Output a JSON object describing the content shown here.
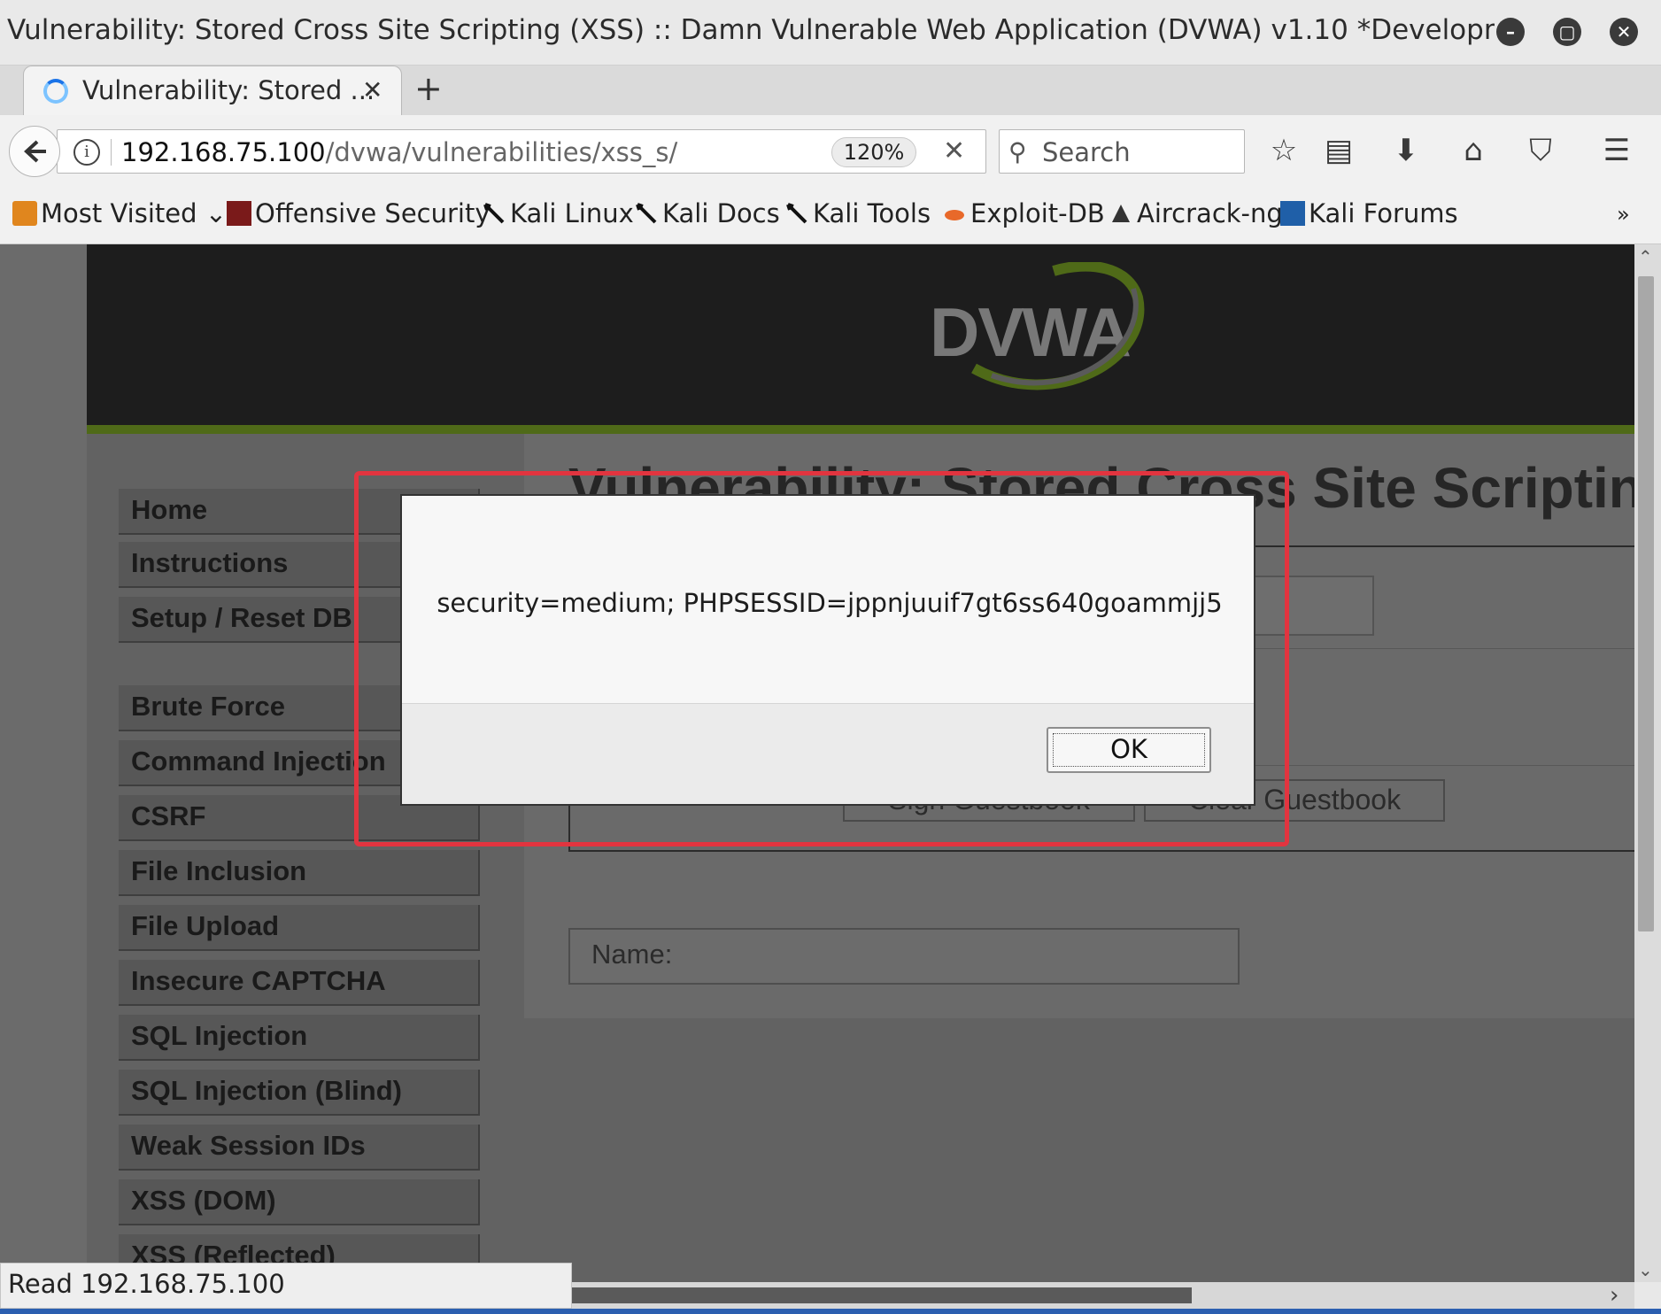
{
  "window": {
    "title": "Vulnerability: Stored Cross Site Scripting (XSS) :: Damn Vulnerable Web Application (DVWA) v1.10 *Development* - Mozill...",
    "minimize_glyph": "–",
    "maximize_glyph": "▢",
    "close_glyph": "✕"
  },
  "tab": {
    "label": "Vulnerability: Stored ...",
    "close_glyph": "✕",
    "new_tab_glyph": "+"
  },
  "navbar": {
    "back_glyph": "🡐",
    "url_host": "192.168.75.100",
    "url_path": "/dvwa/vulnerabilities/xss_s/",
    "zoom": "120%",
    "stop_glyph": "✕",
    "search_placeholder": "Search",
    "icons": [
      "bookmark-star-icon",
      "reading-list-icon",
      "download-icon",
      "home-icon",
      "pocket-icon",
      "hamburger-menu-icon"
    ]
  },
  "bookmarks": [
    {
      "label": "Most Visited",
      "icon": "folder-icon",
      "color": "#e0861e"
    },
    {
      "label": "Offensive Security",
      "icon": "offsec-icon",
      "color": "#7a1a1a"
    },
    {
      "label": "Kali Linux",
      "icon": "kali-dragon-icon",
      "color": "#111111"
    },
    {
      "label": "Kali Docs",
      "icon": "kali-dragon-icon",
      "color": "#111111"
    },
    {
      "label": "Kali Tools",
      "icon": "kali-dragon-icon",
      "color": "#111111"
    },
    {
      "label": "Exploit-DB",
      "icon": "exploit-db-icon",
      "color": "#e8692a"
    },
    {
      "label": "Aircrack-ng",
      "icon": "aircrack-icon",
      "color": "#333333"
    },
    {
      "label": "Kali Forums",
      "icon": "kali-forums-icon",
      "color": "#1f5fa8"
    }
  ],
  "bookmarks_overflow": "»",
  "dvwa": {
    "logo_text": "DVWA",
    "page_heading": "Vulnerability: Stored Cross Site Scripting",
    "menu": [
      "Home",
      "Instructions",
      "Setup / Reset DB",
      "Brute Force",
      "Command Injection",
      "CSRF",
      "File Inclusion",
      "File Upload",
      "Insecure CAPTCHA",
      "SQL Injection",
      "SQL Injection (Blind)",
      "Weak Session IDs",
      "XSS (DOM)",
      "XSS (Reflected)"
    ],
    "sign_button": "Sign Guestbook",
    "clear_button": "Clear Guestbook",
    "name_entry_label": "Name:"
  },
  "alert": {
    "message": "security=medium; PHPSESSID=jppnjuuif7gt6ss640goammjj5",
    "ok_label": "OK"
  },
  "status_text": "Read 192.168.75.100",
  "colors": {
    "highlight": "#e2343f",
    "dvwa_green": "#4f6a18"
  }
}
